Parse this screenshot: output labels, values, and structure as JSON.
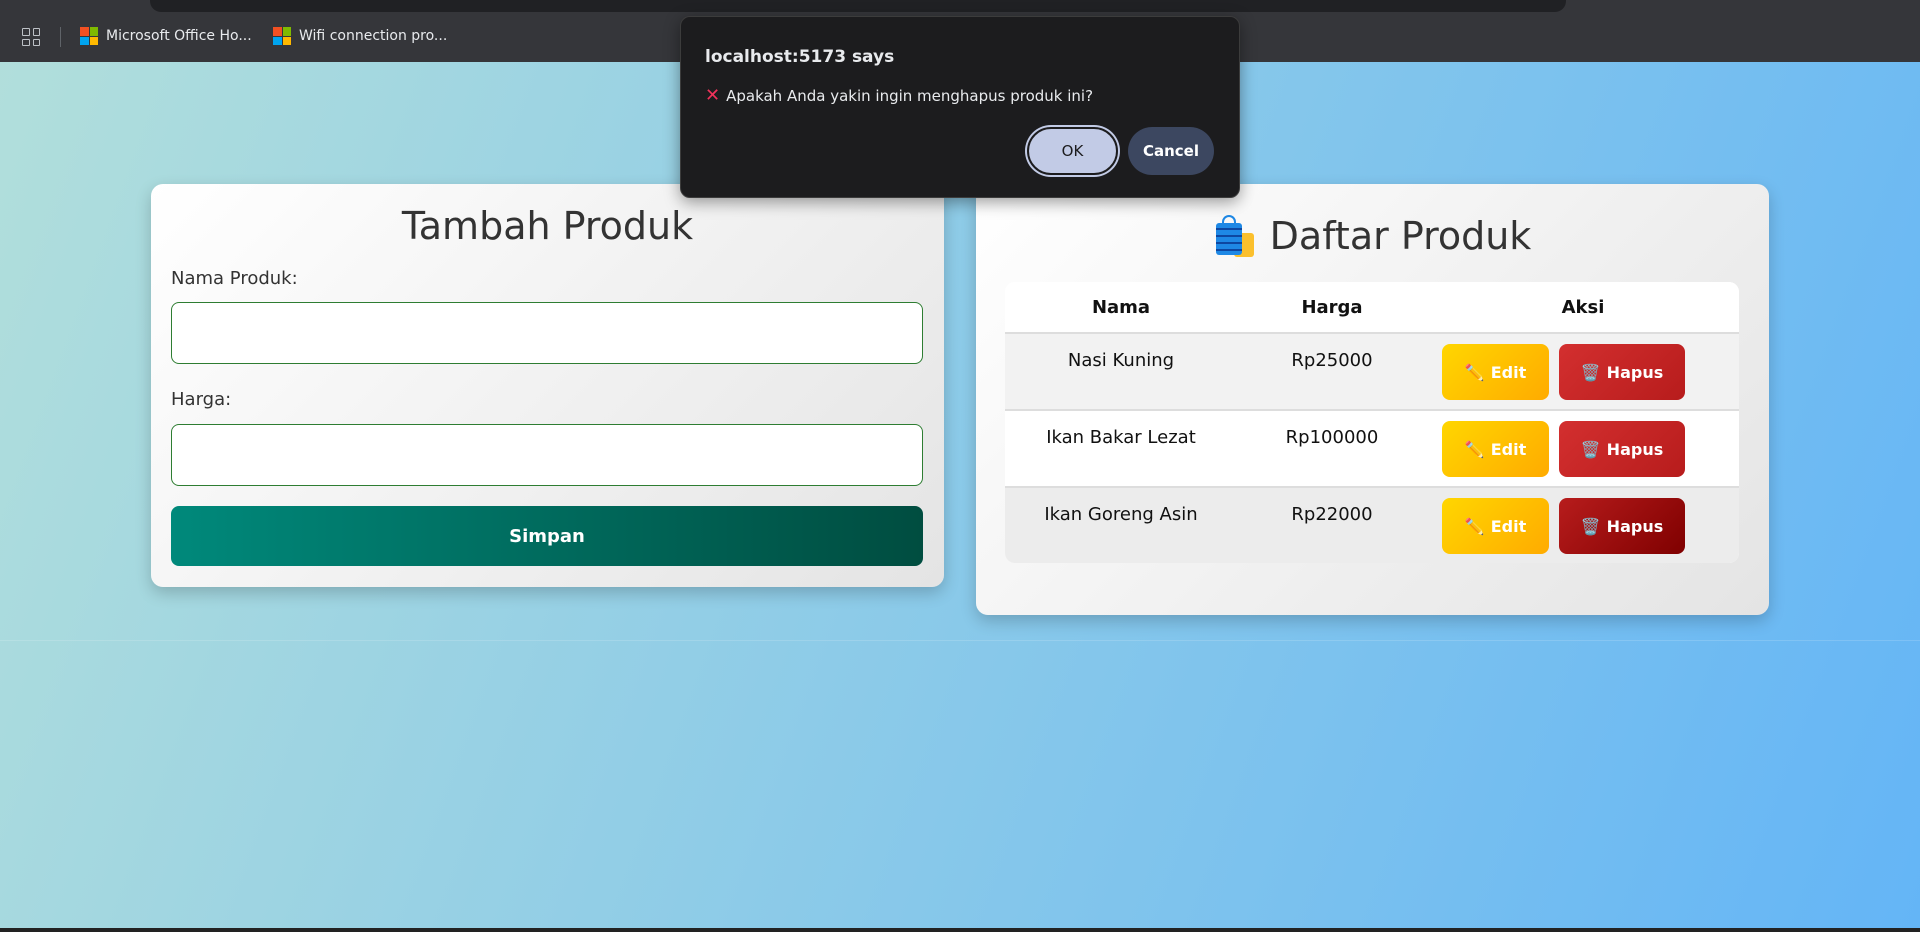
{
  "browser": {
    "bookmarks": [
      {
        "label": "Microsoft Office Ho...",
        "icon": "microsoft-icon"
      },
      {
        "label": "Wifi connection pro...",
        "icon": "microsoft-icon"
      }
    ]
  },
  "form": {
    "title": "Tambah Produk",
    "name_label": "Nama Produk:",
    "name_value": "",
    "price_label": "Harga:",
    "price_value": "",
    "save_label": "Simpan"
  },
  "list": {
    "title": "Daftar Produk",
    "icon": "shopping-bag-icon",
    "headers": [
      "Nama",
      "Harga",
      "Aksi"
    ],
    "rows": [
      {
        "name": "Nasi Kuning",
        "price": "Rp25000"
      },
      {
        "name": "Ikan Bakar Lezat",
        "price": "Rp100000"
      },
      {
        "name": "Ikan Goreng Asin",
        "price": "Rp22000"
      }
    ],
    "edit_label": "Edit",
    "delete_label": "Hapus"
  },
  "dialog": {
    "title": "localhost:5173 says",
    "icon": "cross-mark-icon",
    "message": "Apakah Anda yakin ingin menghapus produk ini?",
    "ok_label": "OK",
    "cancel_label": "Cancel"
  },
  "colors": {
    "primary": "#00897b",
    "edit": "#ffc107",
    "delete": "#c62828"
  }
}
